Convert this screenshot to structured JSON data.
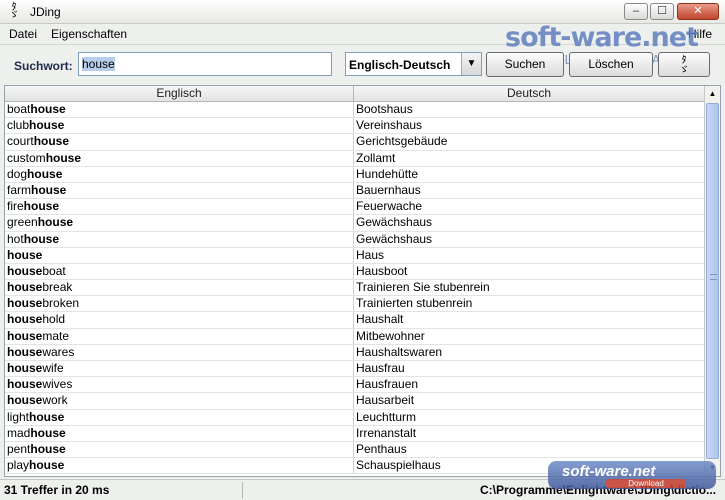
{
  "window": {
    "title": "JDing",
    "minimize": "–",
    "maximize": "☐",
    "close": "✕"
  },
  "menu": {
    "items": [
      "Datei",
      "Eigenschaften"
    ],
    "help": "Hilfe"
  },
  "watermark": {
    "brand": "soft-ware.net",
    "tagline": "AKTUELLE DOWNLOADS",
    "badge": "soft-ware.net",
    "badge_sub": "Download"
  },
  "search": {
    "label": "Suchwort:",
    "value": "house",
    "direction": "Englisch-Deutsch",
    "search_button": "Suchen",
    "clear_button": "Löschen"
  },
  "table": {
    "columns": [
      "Englisch",
      "Deutsch"
    ],
    "rows": [
      {
        "pre": "boat",
        "match": "house",
        "post": "",
        "de": "Bootshaus"
      },
      {
        "pre": "club",
        "match": "house",
        "post": "",
        "de": "Vereinshaus"
      },
      {
        "pre": "court",
        "match": "house",
        "post": "",
        "de": "Gerichtsgebäude"
      },
      {
        "pre": "custom",
        "match": "house",
        "post": "",
        "de": "Zollamt"
      },
      {
        "pre": "dog",
        "match": "house",
        "post": "",
        "de": "Hundehütte"
      },
      {
        "pre": "farm",
        "match": "house",
        "post": "",
        "de": "Bauernhaus"
      },
      {
        "pre": "fire",
        "match": "house",
        "post": "",
        "de": "Feuerwache"
      },
      {
        "pre": "green",
        "match": "house",
        "post": "",
        "de": "Gewächshaus"
      },
      {
        "pre": "hot",
        "match": "house",
        "post": "",
        "de": "Gewächshaus"
      },
      {
        "pre": "",
        "match": "house",
        "post": "",
        "de": "Haus"
      },
      {
        "pre": "",
        "match": "house",
        "post": "boat",
        "de": "Hausboot"
      },
      {
        "pre": "",
        "match": "house",
        "post": "break",
        "de": "Trainieren Sie stubenrein"
      },
      {
        "pre": "",
        "match": "house",
        "post": "broken",
        "de": "Trainierten stubenrein"
      },
      {
        "pre": "",
        "match": "house",
        "post": "hold",
        "de": "Haushalt"
      },
      {
        "pre": "",
        "match": "house",
        "post": "mate",
        "de": "Mitbewohner"
      },
      {
        "pre": "",
        "match": "house",
        "post": "wares",
        "de": "Haushaltswaren"
      },
      {
        "pre": "",
        "match": "house",
        "post": "wife",
        "de": "Hausfrau"
      },
      {
        "pre": "",
        "match": "house",
        "post": "wives",
        "de": "Hausfrauen"
      },
      {
        "pre": "",
        "match": "house",
        "post": "work",
        "de": "Hausarbeit"
      },
      {
        "pre": "light",
        "match": "house",
        "post": "",
        "de": "Leuchtturm"
      },
      {
        "pre": "mad",
        "match": "house",
        "post": "",
        "de": "Irrenanstalt"
      },
      {
        "pre": "pent",
        "match": "house",
        "post": "",
        "de": "Penthaus"
      },
      {
        "pre": "play",
        "match": "house",
        "post": "",
        "de": "Schauspielhaus"
      }
    ]
  },
  "status": {
    "result": "31 Treffer in 20 ms",
    "path": "C:\\Programme\\Enlightware\\JDing\\dictio..."
  }
}
